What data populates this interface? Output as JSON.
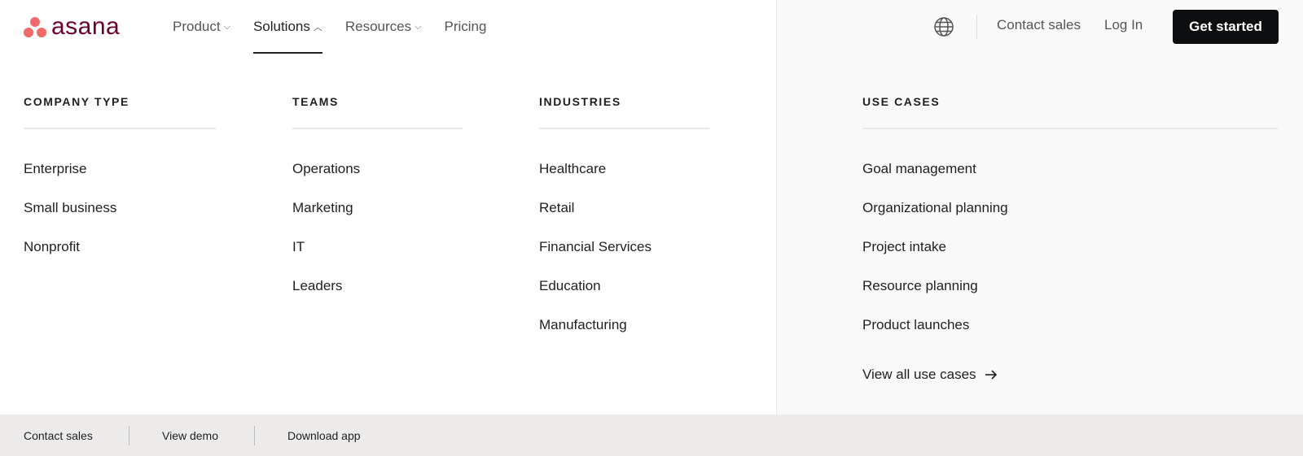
{
  "brand": {
    "logo_text": "asana",
    "dot_color": "#f06a6a",
    "text_color": "#690031"
  },
  "nav": {
    "items": [
      {
        "label": "Product",
        "has_chevron": true,
        "chevron": "⌵"
      },
      {
        "label": "Solutions",
        "has_chevron": true,
        "chevron": "︿",
        "active": true
      },
      {
        "label": "Resources",
        "has_chevron": true,
        "chevron": "⌵"
      },
      {
        "label": "Pricing",
        "has_chevron": false
      }
    ]
  },
  "header": {
    "globe_icon": "globe-icon",
    "contact_sales": "Contact sales",
    "log_in": "Log In",
    "get_started": "Get started"
  },
  "menu": {
    "company_type": {
      "heading": "COMPANY TYPE",
      "items": [
        "Enterprise",
        "Small business",
        "Nonprofit"
      ]
    },
    "teams": {
      "heading": "TEAMS",
      "items": [
        "Operations",
        "Marketing",
        "IT",
        "Leaders"
      ]
    },
    "industries": {
      "heading": "INDUSTRIES",
      "items": [
        "Healthcare",
        "Retail",
        "Financial Services",
        "Education",
        "Manufacturing"
      ]
    },
    "use_cases": {
      "heading": "USE CASES",
      "items": [
        "Goal management",
        "Organizational planning",
        "Project intake",
        "Resource planning",
        "Product launches"
      ],
      "view_all": "View all use cases",
      "arrow_icon": "arrow-right-icon"
    }
  },
  "footer": {
    "contact_sales": "Contact sales",
    "view_demo": "View demo",
    "download_app": "Download app"
  }
}
